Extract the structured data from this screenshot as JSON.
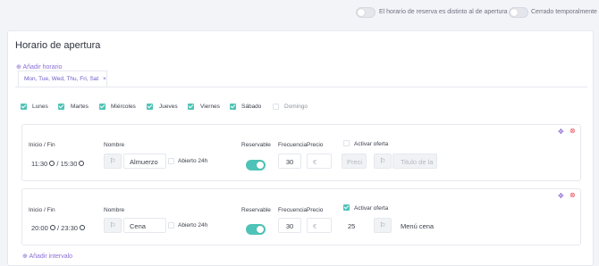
{
  "header": {
    "reservation_toggle_label": "El horario de reserva es distinto al de apertura",
    "closed_toggle_label": "Cerrado temporalmente"
  },
  "section": {
    "title": "Horario de apertura",
    "add_schedule": "Añadir horario",
    "tab_label": "Mon, Tue, Wed, Thu, Fri, Sat",
    "tab_close": "×"
  },
  "days": [
    {
      "label": "Lunes",
      "checked": true
    },
    {
      "label": "Martes",
      "checked": true
    },
    {
      "label": "Miércoles",
      "checked": true
    },
    {
      "label": "Jueves",
      "checked": true
    },
    {
      "label": "Viernes",
      "checked": true
    },
    {
      "label": "Sábado",
      "checked": true
    },
    {
      "label": "Domingo",
      "checked": false
    }
  ],
  "labels": {
    "start_end": "Inicio / Fin",
    "name": "Nombre",
    "open24": "Abierto 24h",
    "reservable": "Reservable",
    "frequency": "Frecuencia",
    "price": "Precio",
    "activate_offer": "Activar oferta",
    "time_sep": "/",
    "euro": "€"
  },
  "intervals": [
    {
      "start": "11:30",
      "end": "15:30",
      "name": "Almuerzo",
      "open24": false,
      "reservable": true,
      "frequency": "30",
      "price_placeholder": "€",
      "offer_active": false,
      "offer_price": "Preci",
      "offer_title": "Titulo de la"
    },
    {
      "start": "20:00",
      "end": "23:30",
      "name": "Cena",
      "open24": false,
      "reservable": true,
      "frequency": "30",
      "price_placeholder": "€",
      "offer_active": true,
      "offer_price": "25",
      "offer_title": "Menú cena"
    }
  ],
  "footer": {
    "add_interval": "Añadir intervalo"
  },
  "colors": {
    "accent": "#8a6fd6",
    "toggle_on": "#4fc3b7",
    "delete": "#e8505b"
  }
}
